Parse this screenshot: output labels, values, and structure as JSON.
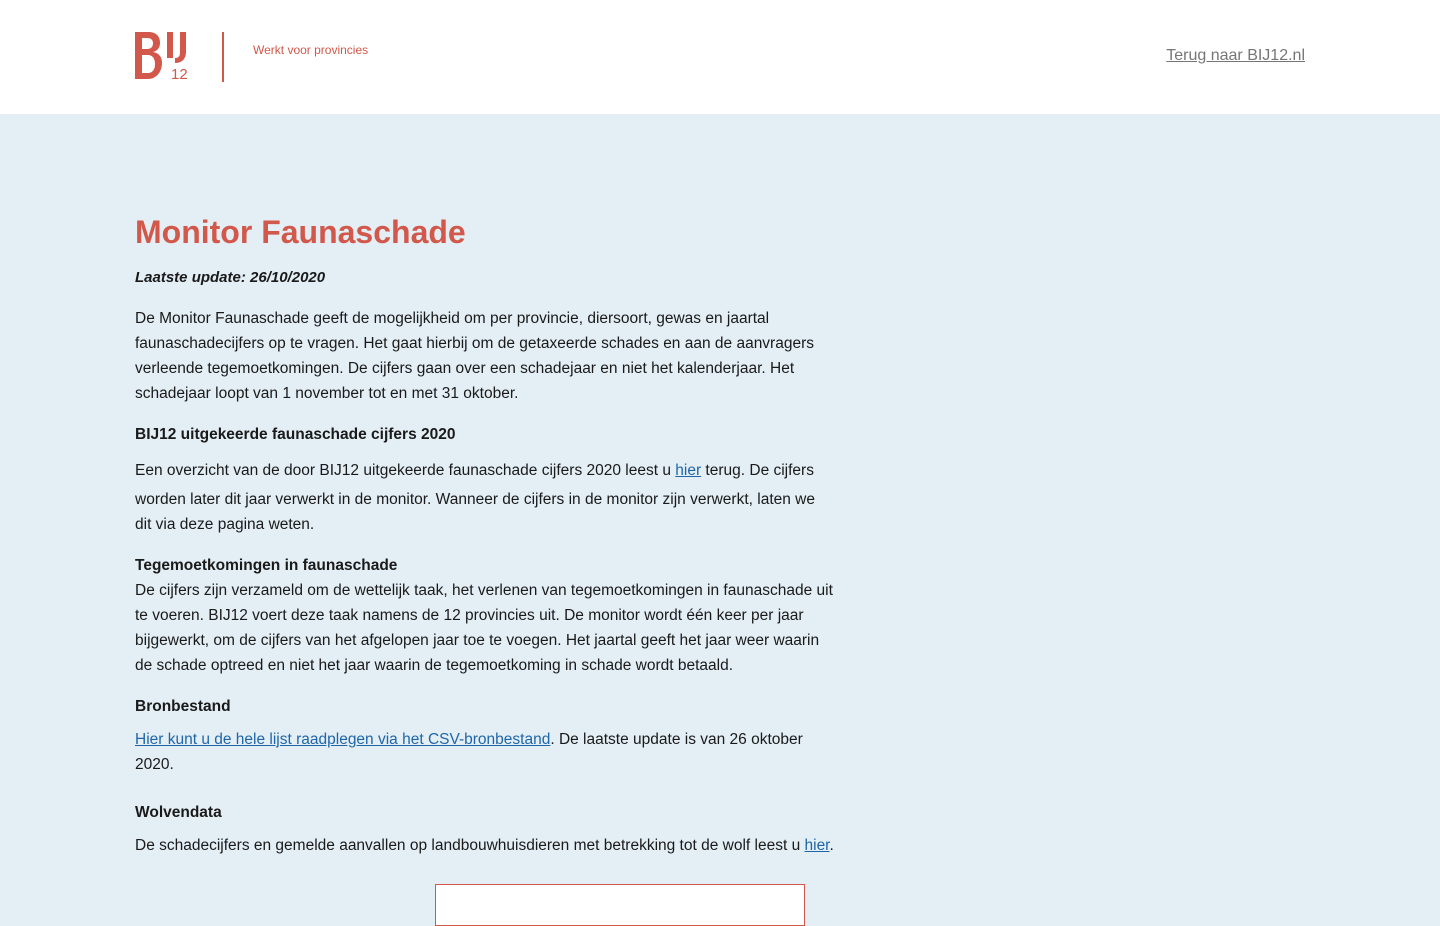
{
  "header": {
    "logo_alt": "BIJ12",
    "tagline": "Werkt voor provincies",
    "back_link": "Terug naar BIJ12.nl"
  },
  "colors": {
    "accent": "#d1584a",
    "link": "#1f66a8",
    "background": "#e3eef5"
  },
  "main": {
    "title": "Monitor Faunaschade",
    "update": "Laatste update: 26/10/2020",
    "intro": "De Monitor Faunaschade geeft de mogelijkheid om per provincie, diersoort, gewas en jaartal faunaschadecijfers op te vragen. Het gaat hierbij om de getaxeerde schades en aan de aanvragers verleende tegemoetkomingen. De cijfers gaan over een schadejaar en niet het kalenderjaar. Het schadejaar loopt van 1 november tot en met 31 oktober.",
    "section1": {
      "title": "BIJ12 uitgekeerde faunaschade cijfers 2020",
      "text_before": "Een overzicht van de door BIJ12 uitgekeerde faunaschade cijfers 2020 leest u ",
      "link": "hier",
      "text_after": " terug. De cijfers worden later dit jaar verwerkt in de monitor. Wanneer de cijfers in de monitor zijn verwerkt, laten we dit via deze pagina weten."
    },
    "section2": {
      "title": "Tegemoetkomingen in faunaschade",
      "text": "De cijfers zijn verzameld om de wettelijk taak, het verlenen van tegemoetkomingen in faunaschade uit te voeren. BIJ12 voert deze taak namens de 12 provincies uit. De monitor wordt één keer per jaar bijgewerkt, om de cijfers van het afgelopen jaar toe te voegen. Het jaartal geeft het jaar weer waarin de schade optreed en niet het jaar waarin de tegemoetkoming in schade wordt betaald."
    },
    "section3": {
      "title": "Bronbestand",
      "link": "Hier kunt u de hele lijst raadplegen via het CSV-bronbestand",
      "text_after": ". De laatste update is van 26 oktober 2020."
    },
    "section4": {
      "title": "Wolvendata",
      "text_before": "De schadecijfers en gemelde aanvallen op landbouwhuisdieren met betrekking tot de wolf leest u ",
      "link": "hier",
      "text_after": "."
    }
  }
}
